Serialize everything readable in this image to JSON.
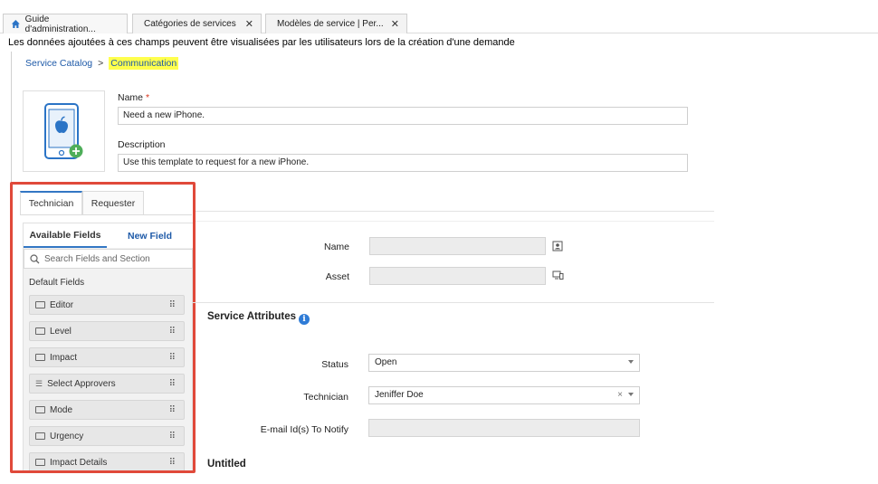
{
  "tabs": [
    {
      "label": "Guide d'administration..."
    },
    {
      "label": "Catégories de services",
      "close": "✕"
    },
    {
      "label": "Modèles de service | Per...",
      "close": "✕"
    }
  ],
  "note": "Les données ajoutées à ces champs peuvent être visualisées par les utilisateurs lors de la création d'une demande",
  "breadcrumb": {
    "root": "Service Catalog",
    "sep": ">",
    "current": "Communication"
  },
  "template": {
    "name_label": "Name",
    "required": "*",
    "name_value": "Need a new iPhone.",
    "description_label": "Description",
    "description_value": "Use this template to request for a new iPhone."
  },
  "panel": {
    "tab_technician": "Technician",
    "tab_requester": "Requester",
    "available_fields": "Available Fields",
    "new_field": "New Field",
    "search_placeholder": "Search Fields and Section",
    "default_fields": "Default Fields",
    "items": [
      {
        "label": "Editor"
      },
      {
        "label": "Level"
      },
      {
        "label": "Impact"
      },
      {
        "label": "Select Approvers"
      },
      {
        "label": "Mode"
      },
      {
        "label": "Urgency"
      },
      {
        "label": "Impact Details"
      }
    ]
  },
  "form": {
    "name_label": "Name",
    "asset_label": "Asset",
    "service_attributes": "Service Attributes",
    "status_label": "Status",
    "status_value": "Open",
    "technician_label": "Technician",
    "technician_value": "Jeniffer Doe",
    "clear": "×",
    "email_label": "E-mail Id(s) To Notify",
    "untitled": "Untitled"
  },
  "colors": {
    "accent": "#3377c4",
    "highlight": "#ffff4d",
    "annotation": "#e0493a",
    "info": "#2e7bd6"
  }
}
